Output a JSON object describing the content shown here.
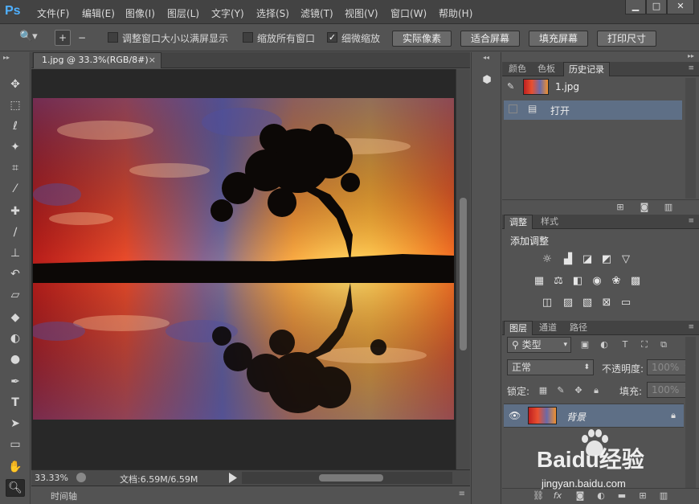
{
  "app": {
    "logo": "Ps"
  },
  "menu": [
    "文件(F)",
    "编辑(E)",
    "图像(I)",
    "图层(L)",
    "文字(Y)",
    "选择(S)",
    "滤镜(T)",
    "视图(V)",
    "窗口(W)",
    "帮助(H)"
  ],
  "window_buttons": {
    "minimize": "▁",
    "maximize": "□",
    "close": "✕"
  },
  "options": {
    "tool_icon": "zoom-icon",
    "resize_windows": {
      "label": "调整窗口大小以满屏显示",
      "checked": false
    },
    "zoom_all_windows": {
      "label": "缩放所有窗口",
      "checked": false
    },
    "scrubby_zoom": {
      "label": "细微缩放",
      "checked": true
    },
    "buttons": [
      "实际像素",
      "适合屏幕",
      "填充屏幕",
      "打印尺寸"
    ]
  },
  "tools": [
    "move-tool",
    "marquee-tool",
    "lasso-tool",
    "magic-wand-tool",
    "crop-tool",
    "eyedropper-tool",
    "healing-brush-tool",
    "brush-tool",
    "clone-stamp-tool",
    "history-brush-tool",
    "eraser-tool",
    "paint-bucket-tool",
    "blur-tool",
    "dodge-tool",
    "pen-tool",
    "type-tool",
    "path-selection-tool",
    "rectangle-tool",
    "hand-tool",
    "zoom-tool"
  ],
  "document": {
    "tab_title": "1.jpg @ 33.3%(RGB/8#)",
    "tab_close": "×",
    "zoom": "33.33%",
    "doc_info": "文档:6.59M/6.59M"
  },
  "timeline": {
    "label": "时间轴"
  },
  "history_panel": {
    "tabs": [
      "颜色",
      "色板",
      "历史记录"
    ],
    "active_tab": "历史记录",
    "snapshot": "1.jpg",
    "steps": [
      "打开"
    ]
  },
  "adjustments_panel": {
    "tabs": [
      "调整",
      "样式"
    ],
    "active_tab": "调整",
    "title": "添加调整"
  },
  "layers_panel": {
    "tabs": [
      "图层",
      "通道",
      "路径"
    ],
    "active_tab": "图层",
    "filter_kind": "类型",
    "blend_mode": "正常",
    "opacity_label": "不透明度:",
    "opacity": "100%",
    "lock_label": "锁定:",
    "fill_label": "填充:",
    "fill": "100%",
    "layers": [
      {
        "name": "背景",
        "locked": true,
        "visible": true
      }
    ]
  },
  "watermark": {
    "brand": "Baidu经验",
    "url": "jingyan.baidu.com"
  },
  "colors": {
    "selection": "#5e6f86",
    "accent_logo": "#4fb0ff"
  }
}
